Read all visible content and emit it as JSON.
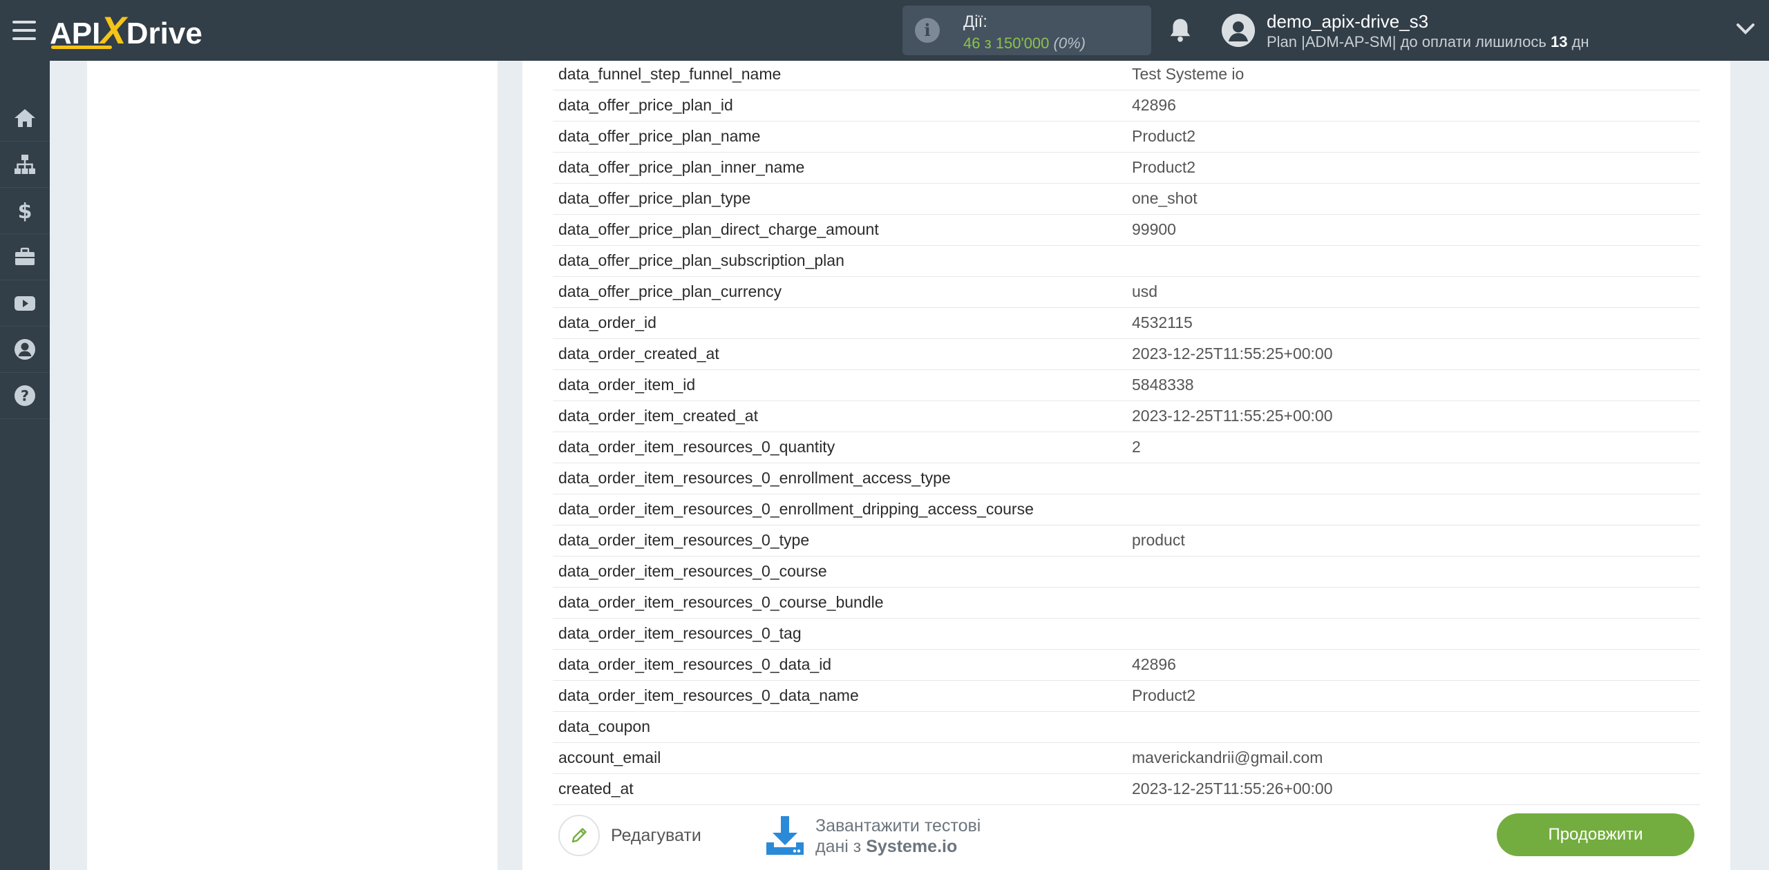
{
  "header": {
    "logo_left": "API",
    "logo_x": "X",
    "logo_right": "Drive",
    "actions_label": "Дії:",
    "actions_value": "46 з 150'000",
    "actions_percent": "(0%)",
    "user_name": "demo_apix-drive_s3",
    "plan_text": "Plan |ADM-AP-SM| до оплати лишилось",
    "plan_days": "13",
    "plan_days_unit": "дн"
  },
  "sidebar": {
    "items": [
      "home-icon",
      "sitemap-icon",
      "dollar-icon",
      "briefcase-icon",
      "youtube-icon",
      "user-icon",
      "help-icon"
    ]
  },
  "table": {
    "rows": [
      {
        "key": "data_funnel_step_funnel_name",
        "value": "Test Systeme io"
      },
      {
        "key": "data_offer_price_plan_id",
        "value": "42896"
      },
      {
        "key": "data_offer_price_plan_name",
        "value": "Product2"
      },
      {
        "key": "data_offer_price_plan_inner_name",
        "value": "Product2"
      },
      {
        "key": "data_offer_price_plan_type",
        "value": "one_shot"
      },
      {
        "key": "data_offer_price_plan_direct_charge_amount",
        "value": "99900"
      },
      {
        "key": "data_offer_price_plan_subscription_plan",
        "value": ""
      },
      {
        "key": "data_offer_price_plan_currency",
        "value": "usd"
      },
      {
        "key": "data_order_id",
        "value": "4532115"
      },
      {
        "key": "data_order_created_at",
        "value": "2023-12-25T11:55:25+00:00"
      },
      {
        "key": "data_order_item_id",
        "value": "5848338"
      },
      {
        "key": "data_order_item_created_at",
        "value": "2023-12-25T11:55:25+00:00"
      },
      {
        "key": "data_order_item_resources_0_quantity",
        "value": "2"
      },
      {
        "key": "data_order_item_resources_0_enrollment_access_type",
        "value": ""
      },
      {
        "key": "data_order_item_resources_0_enrollment_dripping_access_course",
        "value": ""
      },
      {
        "key": "data_order_item_resources_0_type",
        "value": "product"
      },
      {
        "key": "data_order_item_resources_0_course",
        "value": ""
      },
      {
        "key": "data_order_item_resources_0_course_bundle",
        "value": ""
      },
      {
        "key": "data_order_item_resources_0_tag",
        "value": ""
      },
      {
        "key": "data_order_item_resources_0_data_id",
        "value": "42896"
      },
      {
        "key": "data_order_item_resources_0_data_name",
        "value": "Product2"
      },
      {
        "key": "data_coupon",
        "value": ""
      },
      {
        "key": "account_email",
        "value": "maverickandrii@gmail.com"
      },
      {
        "key": "created_at",
        "value": "2023-12-25T11:55:26+00:00"
      }
    ]
  },
  "footer": {
    "edit_label": "Редагувати",
    "download_line1": "Завантажити тестові",
    "download_line2_prefix": "дані з",
    "download_line2_brand": "Systeme.io",
    "continue_label": "Продовжити"
  },
  "colors": {
    "topbar": "#323e48",
    "accent_yellow": "#f5c417",
    "accent_green": "#74ad3f"
  }
}
